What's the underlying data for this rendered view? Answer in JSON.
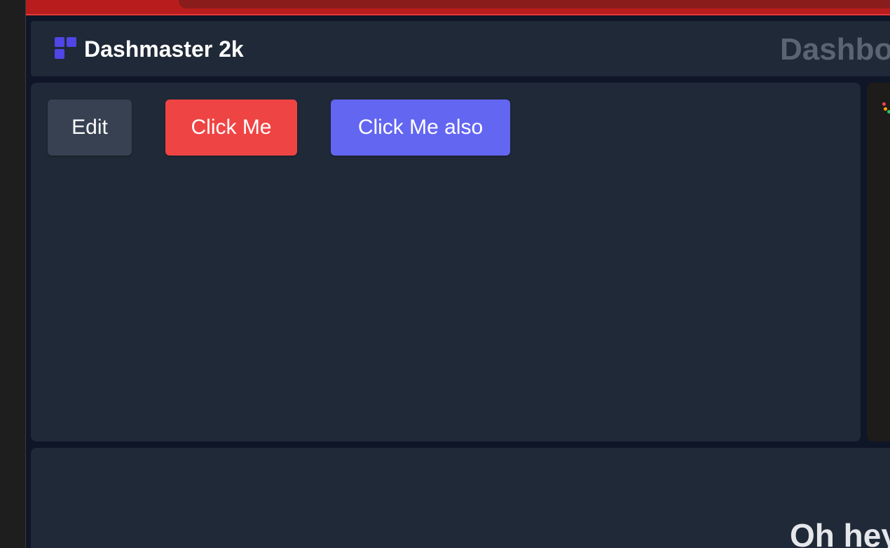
{
  "header": {
    "brand": "Dashmaster 2k",
    "page_heading": "Dashbo"
  },
  "buttons": {
    "edit": "Edit",
    "click_me": "Click Me",
    "click_me_also": "Click Me also"
  },
  "bottom_card": {
    "greeting": "Oh hey"
  },
  "icons": {
    "logo": "dashboard-grid-icon",
    "side_widget": "dots-icon"
  },
  "colors": {
    "accent_indigo": "#6366f1",
    "logo_indigo": "#4f46e5",
    "danger_red": "#ef4444",
    "topbar_red": "#b91c1c",
    "neutral_button": "#374151",
    "card_bg": "#1f2937",
    "app_bg": "#0f1627"
  }
}
